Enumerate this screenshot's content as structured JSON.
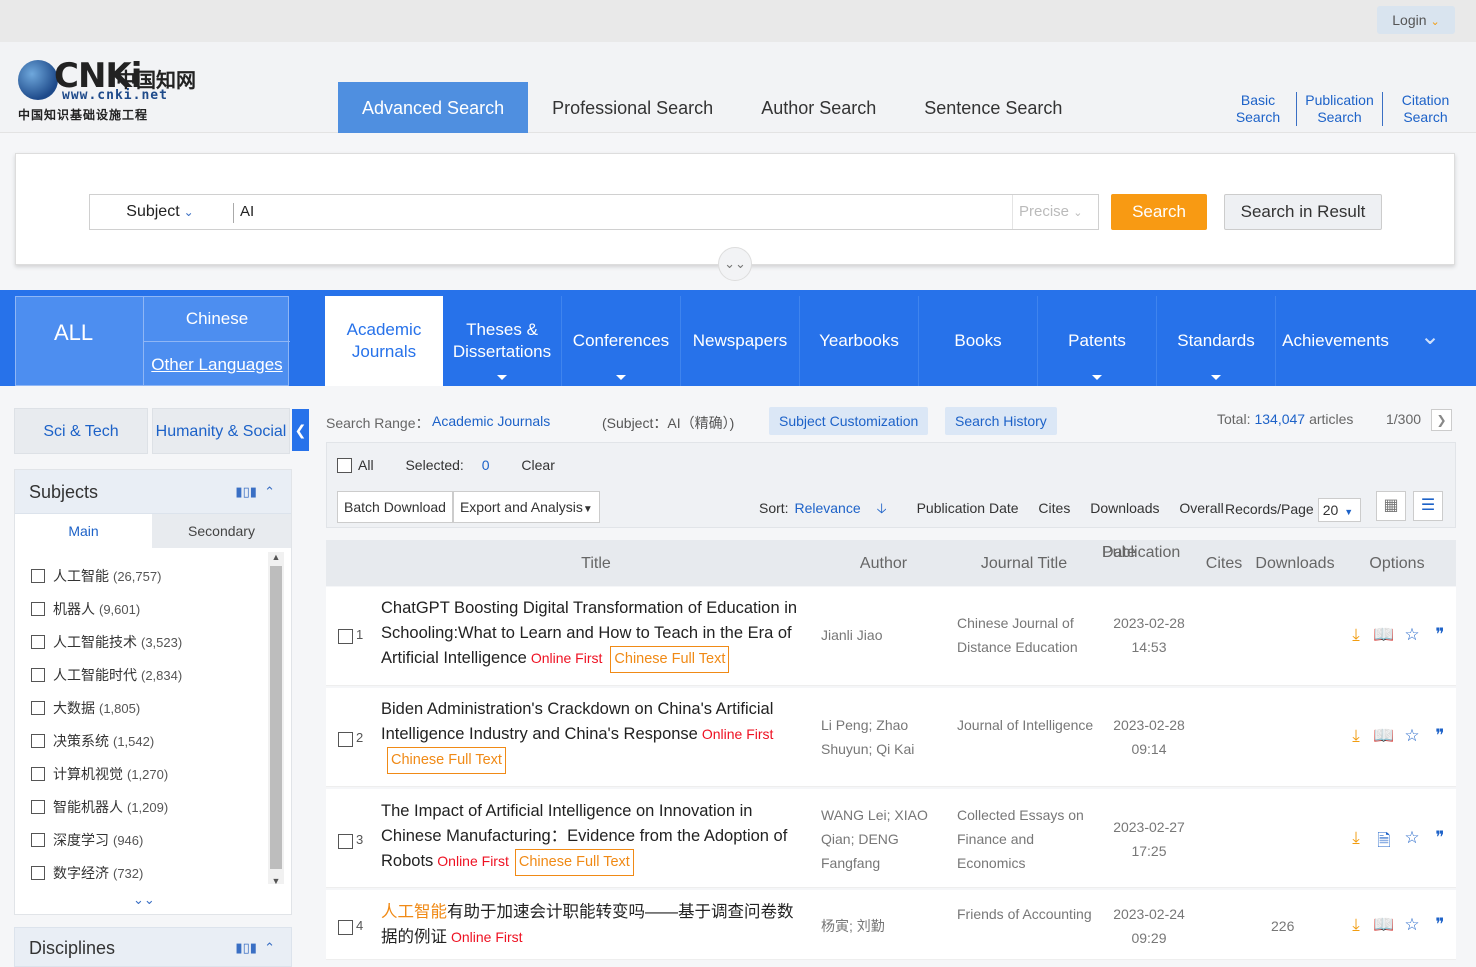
{
  "topbar": {
    "login": "Login"
  },
  "logo": {
    "brand": "CNKi",
    "chinese_name": "中国知网",
    "url": "www.cnki.net",
    "subtitle": "中国知识基础设施工程"
  },
  "header_tabs": [
    "Advanced Search",
    "Professional Search",
    "Author Search",
    "Sentence Search"
  ],
  "header_links": [
    [
      "Basic",
      "Search"
    ],
    [
      "Publication",
      "Search"
    ],
    [
      "Citation",
      "Search"
    ]
  ],
  "search": {
    "field": "Subject",
    "query": "AI",
    "mode": "Precise",
    "search_label": "Search",
    "search_in_result_label": "Search in Result"
  },
  "database_bar": {
    "all": "ALL",
    "chinese": "Chinese",
    "other_languages": "Other Languages",
    "tabs": [
      {
        "label": "Academic Journals",
        "active": true
      },
      {
        "label": "Theses & Dissertations",
        "dropdown": true
      },
      {
        "label": "Conferences",
        "dropdown": true
      },
      {
        "label": "Newspapers"
      },
      {
        "label": "Yearbooks"
      },
      {
        "label": "Books"
      },
      {
        "label": "Patents",
        "dropdown": true
      },
      {
        "label": "Standards",
        "dropdown": true
      },
      {
        "label": "Achievements"
      }
    ]
  },
  "left": {
    "tabs": [
      "Sci & Tech",
      "Humanity & Social"
    ],
    "subjects_title": "Subjects",
    "subtabs": [
      "Main",
      "Secondary"
    ],
    "subjects": [
      {
        "name": "人工智能",
        "count": "(26,757)"
      },
      {
        "name": "机器人",
        "count": "(9,601)"
      },
      {
        "name": "人工智能技术",
        "count": "(3,523)"
      },
      {
        "name": "人工智能时代",
        "count": "(2,834)"
      },
      {
        "name": "大数据",
        "count": "(1,805)"
      },
      {
        "name": "决策系统",
        "count": "(1,542)"
      },
      {
        "name": "计算机视觉",
        "count": "(1,270)"
      },
      {
        "name": "智能机器人",
        "count": "(1,209)"
      },
      {
        "name": "深度学习",
        "count": "(946)"
      },
      {
        "name": "数字经济",
        "count": "(732)"
      }
    ],
    "disciplines_title": "Disciplines"
  },
  "results": {
    "range_label": "Search Range：",
    "range_value": "Academic Journals",
    "condition": "(Subject：AI（精确）)",
    "subject_customization": "Subject Customization",
    "search_history": "Search History",
    "total_label": "Total:",
    "total": "134,047",
    "total_unit": "articles",
    "page": "1/300",
    "select_all": "All",
    "selected_label": "Selected:",
    "selected_count": "0",
    "clear": "Clear",
    "batch_download": "Batch Download",
    "export_analysis": "Export and Analysis",
    "sort_label": "Sort:",
    "sort_options": [
      "Relevance",
      "Publication Date",
      "Cites",
      "Downloads",
      "Overall"
    ],
    "records_label": "Records/Page",
    "records_value": "20",
    "columns": {
      "title": "Title",
      "author": "Author",
      "journal": "Journal Title",
      "pubdate": [
        "Publication",
        "Date"
      ],
      "cites": "Cites",
      "downloads": "Downloads",
      "options": "Options"
    },
    "online_first": "Online First",
    "chinese_full_text": "Chinese Full Text",
    "rows": [
      {
        "num": "1",
        "title": "ChatGPT Boosting Digital Transformation of Education in Schooling:What to Learn and How to Teach in the Era of Artificial Intelligence",
        "authors": "Jianli Jiao",
        "journal": "Chinese Journal of Distance Education",
        "date": "2023-02-28",
        "time": "14:53",
        "downloads": ""
      },
      {
        "num": "2",
        "title": "Biden Administration's Crackdown on China's Artificial Intelligence Industry and China's Response",
        "authors": "Li Peng; Zhao Shuyun; Qi Kai",
        "journal": "Journal of Intelligence",
        "date": "2023-02-28",
        "time": "09:14",
        "downloads": ""
      },
      {
        "num": "3",
        "title": "The Impact of Artificial Intelligence on Innovation in Chinese Manufacturing：Evidence from the Adoption of Robots",
        "authors": "WANG Lei; XIAO Qian; DENG Fangfang",
        "journal": "Collected Essays on Finance and Economics",
        "date": "2023-02-27",
        "time": "17:25",
        "downloads": ""
      },
      {
        "num": "4",
        "title_highlight": "人工智能",
        "title_rest": "有助于加速会计职能转变吗——基于调查问卷数据的例证",
        "authors": "杨寅; 刘勤",
        "journal": "Friends of Accounting",
        "date": "2023-02-24",
        "time": "09:29",
        "downloads": "226"
      }
    ]
  },
  "colors": {
    "accent_blue": "#2772ea",
    "orange": "#f89a13",
    "link_blue": "#1d62c8",
    "online_first_red": "#e12"
  }
}
